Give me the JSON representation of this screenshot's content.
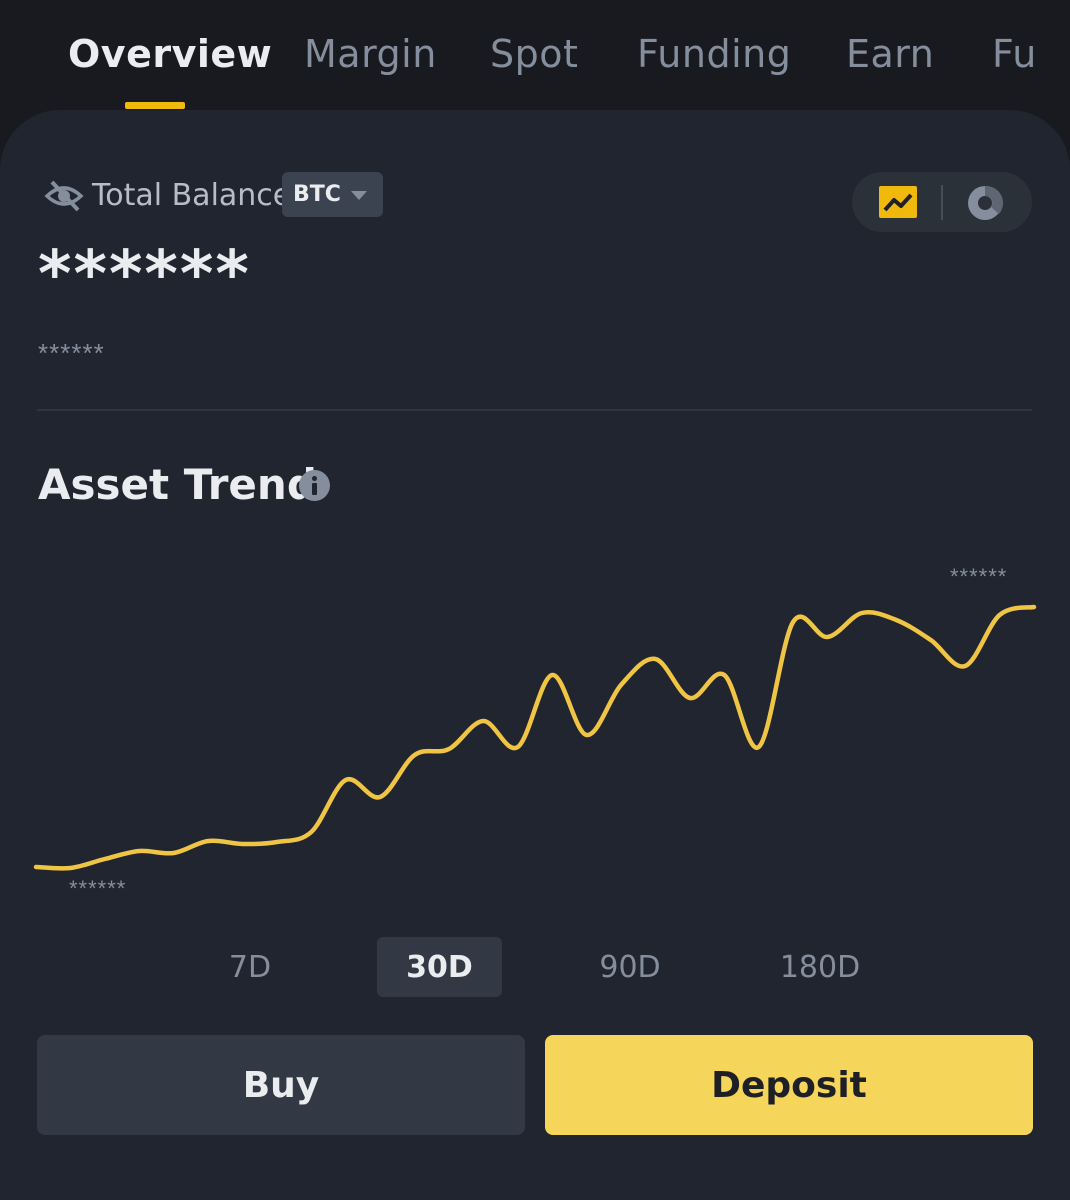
{
  "tabs": [
    {
      "label": "Overview",
      "active": true
    },
    {
      "label": "Margin",
      "active": false
    },
    {
      "label": "Spot",
      "active": false
    },
    {
      "label": "Funding",
      "active": false
    },
    {
      "label": "Earn",
      "active": false
    },
    {
      "label": "Fu",
      "active": false
    }
  ],
  "balance": {
    "label": "Total Balance",
    "currency": "BTC",
    "hidden_value": "******",
    "hidden_sub_value": "******",
    "visibility_icon": "eye-off-icon"
  },
  "view_toggle": {
    "options": [
      "trend-chart-icon",
      "pie-chart-icon"
    ],
    "selected": "trend-chart-icon"
  },
  "asset_trend": {
    "title": "Asset Trend",
    "max_label": "******",
    "min_label": "******"
  },
  "ranges": [
    {
      "label": "7D",
      "active": false
    },
    {
      "label": "30D",
      "active": true
    },
    {
      "label": "90D",
      "active": false
    },
    {
      "label": "180D",
      "active": false
    }
  ],
  "actions": {
    "buy_label": "Buy",
    "deposit_label": "Deposit"
  },
  "colors": {
    "accent": "#f0b90b",
    "line": "#f0c544",
    "deposit": "#f5d55a"
  },
  "chart_data": {
    "type": "line",
    "x": [
      1,
      2,
      3,
      4,
      5,
      6,
      7,
      8,
      9,
      10,
      11,
      12,
      13,
      14,
      15,
      16,
      17,
      18,
      19,
      20,
      21,
      22,
      23,
      24,
      25,
      26,
      27,
      28,
      29,
      30
    ],
    "values": [
      8,
      7,
      16,
      24,
      22,
      34,
      31,
      33,
      43,
      95,
      78,
      120,
      126,
      154,
      128,
      200,
      140,
      190,
      216,
      177,
      200,
      128,
      253,
      238,
      262,
      255,
      235,
      209,
      260,
      268
    ],
    "ylim": [
      0,
      280
    ]
  }
}
